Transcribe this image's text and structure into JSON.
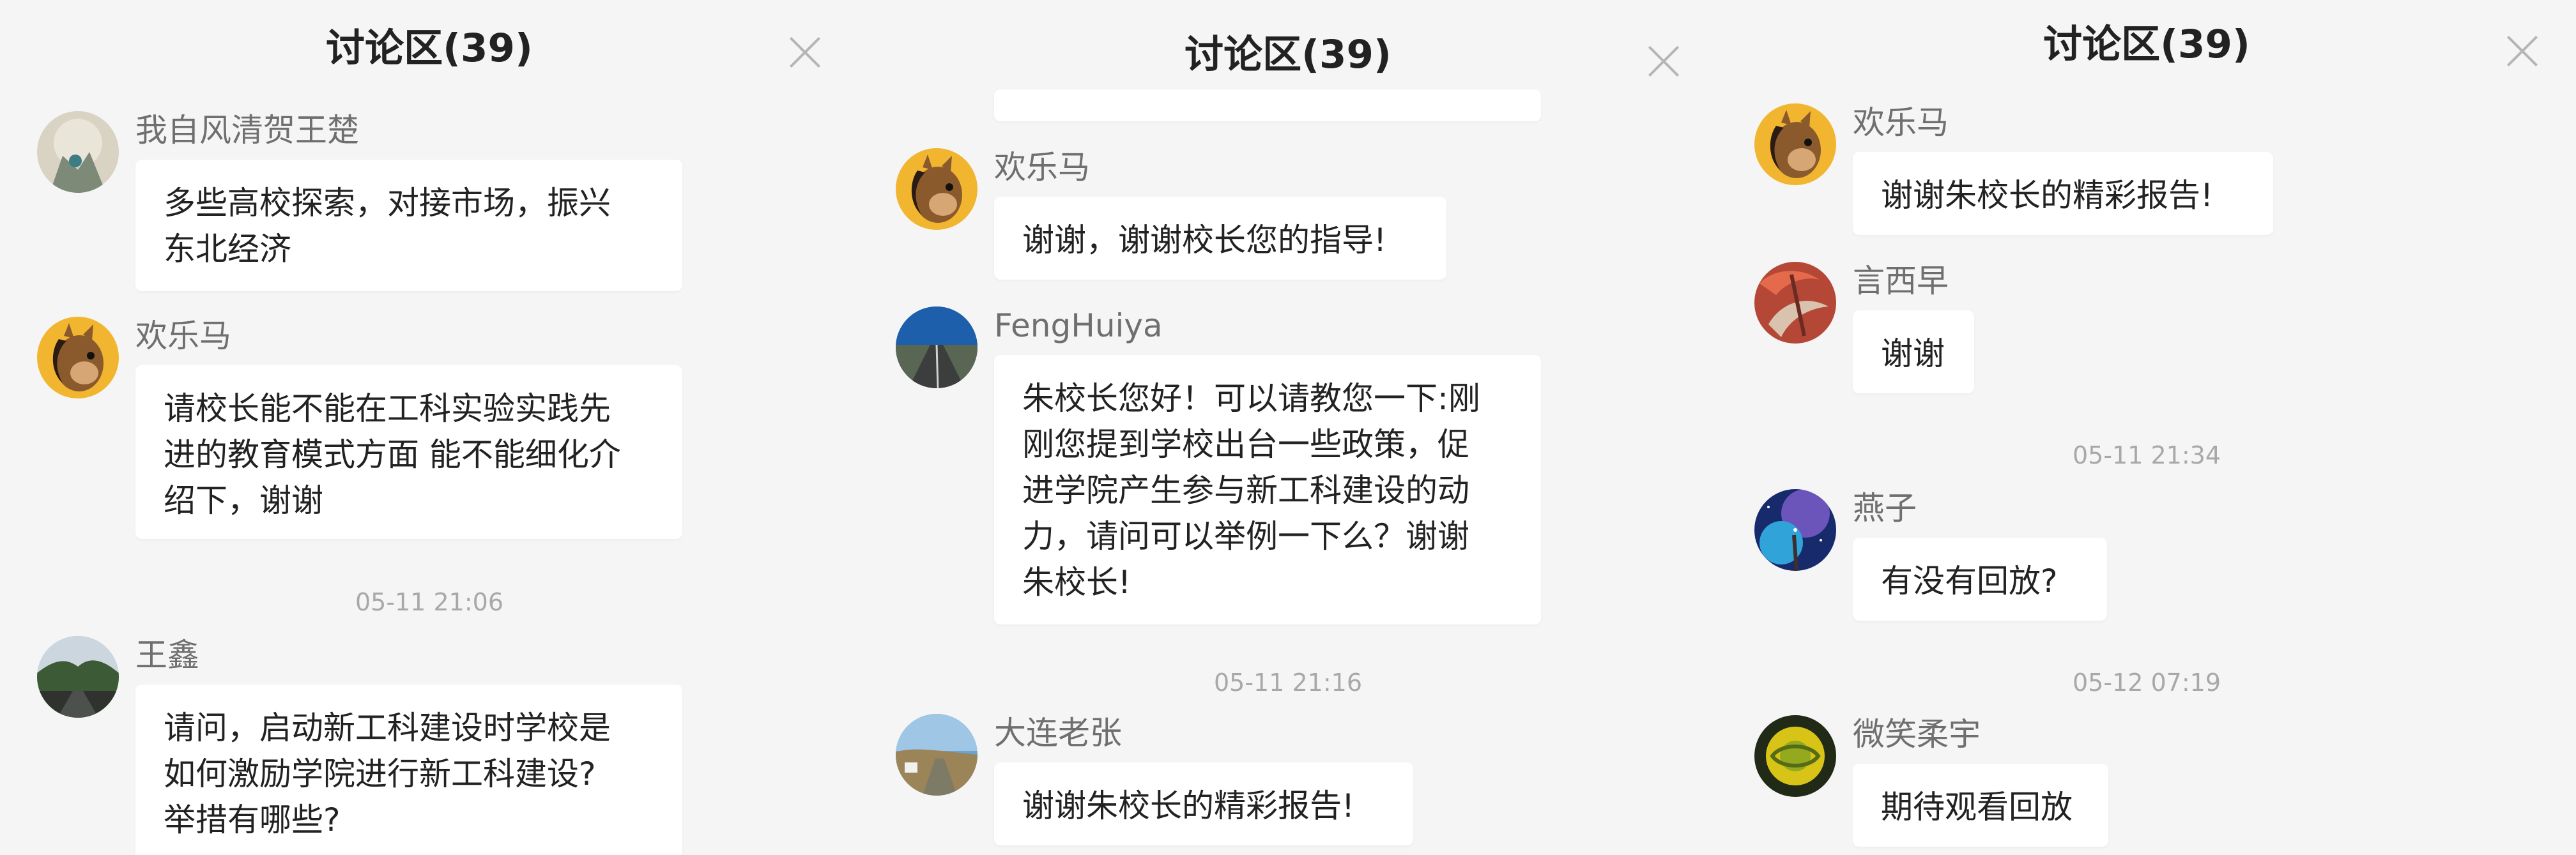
{
  "panels": [
    {
      "title": "讨论区(39)",
      "close_label": "close",
      "messages": [
        {
          "user": "我自风清贺王楚",
          "text": "多些高校探索，对接市场，振兴东北经济",
          "lines": [
            "多些高校探索，对接市场，振兴",
            "东北经济"
          ]
        },
        {
          "user": "欢乐马",
          "text": "请校长能不能在工科实验实践先进的教育模式方面 能不能细化介绍下，谢谢",
          "lines": [
            "请校长能不能在工科实验实践先",
            "进的教育模式方面 能不能细化介",
            "绍下，谢谢"
          ]
        },
        {
          "user": "王鑫",
          "text": "请问，启动新工科建设时学校是如何激励学院进行新工科建设?举措有哪些?",
          "lines": [
            "请问，启动新工科建设时学校是",
            "如何激励学院进行新工科建设?",
            "举措有哪些?"
          ]
        }
      ],
      "timestamps": [
        "05-11 21:06"
      ]
    },
    {
      "title": "讨论区(39)",
      "messages": [
        {
          "user": "欢乐马",
          "text": "谢谢，谢谢校长您的指导!",
          "lines": [
            "谢谢，谢谢校长您的指导!"
          ]
        },
        {
          "user": "FengHuiya",
          "text": "朱校长您好！可以请教您一下:刚刚您提到学校出台一些政策，促进学院产生参与新工科建设的动力，请问可以举例一下么？谢谢朱校长!",
          "lines": [
            "朱校长您好！可以请教您一下:刚",
            "刚您提到学校出台一些政策，促",
            "进学院产生参与新工科建设的动",
            "力，请问可以举例一下么？谢谢",
            "朱校长!"
          ]
        },
        {
          "user": "大连老张",
          "text": "谢谢朱校长的精彩报告!",
          "lines": [
            "谢谢朱校长的精彩报告!"
          ]
        }
      ],
      "timestamps": [
        "05-11 21:16"
      ]
    },
    {
      "title": "讨论区(39)",
      "messages": [
        {
          "user": "欢乐马",
          "text": "谢谢朱校长的精彩报告!",
          "lines": [
            "谢谢朱校长的精彩报告!"
          ]
        },
        {
          "user": "言西早",
          "text": "谢谢",
          "lines": [
            "谢谢"
          ]
        },
        {
          "user": "燕子",
          "text": "有没有回放?",
          "lines": [
            "有没有回放?"
          ]
        },
        {
          "user": "微笑柔宇",
          "text": "期待观看回放",
          "lines": [
            "期待观看回放"
          ]
        }
      ],
      "timestamps": [
        "05-11 21:34",
        "05-12 07:19"
      ]
    }
  ],
  "colors": {
    "background": "#f5f5f5",
    "bubble": "#ffffff",
    "text": "#222222",
    "username": "#6f6f6f",
    "timestamp": "#a8a8a8",
    "close": "#b5b5b5"
  },
  "icons": {
    "close": "close-icon",
    "horse_avatar": "horse-avatar-icon"
  }
}
